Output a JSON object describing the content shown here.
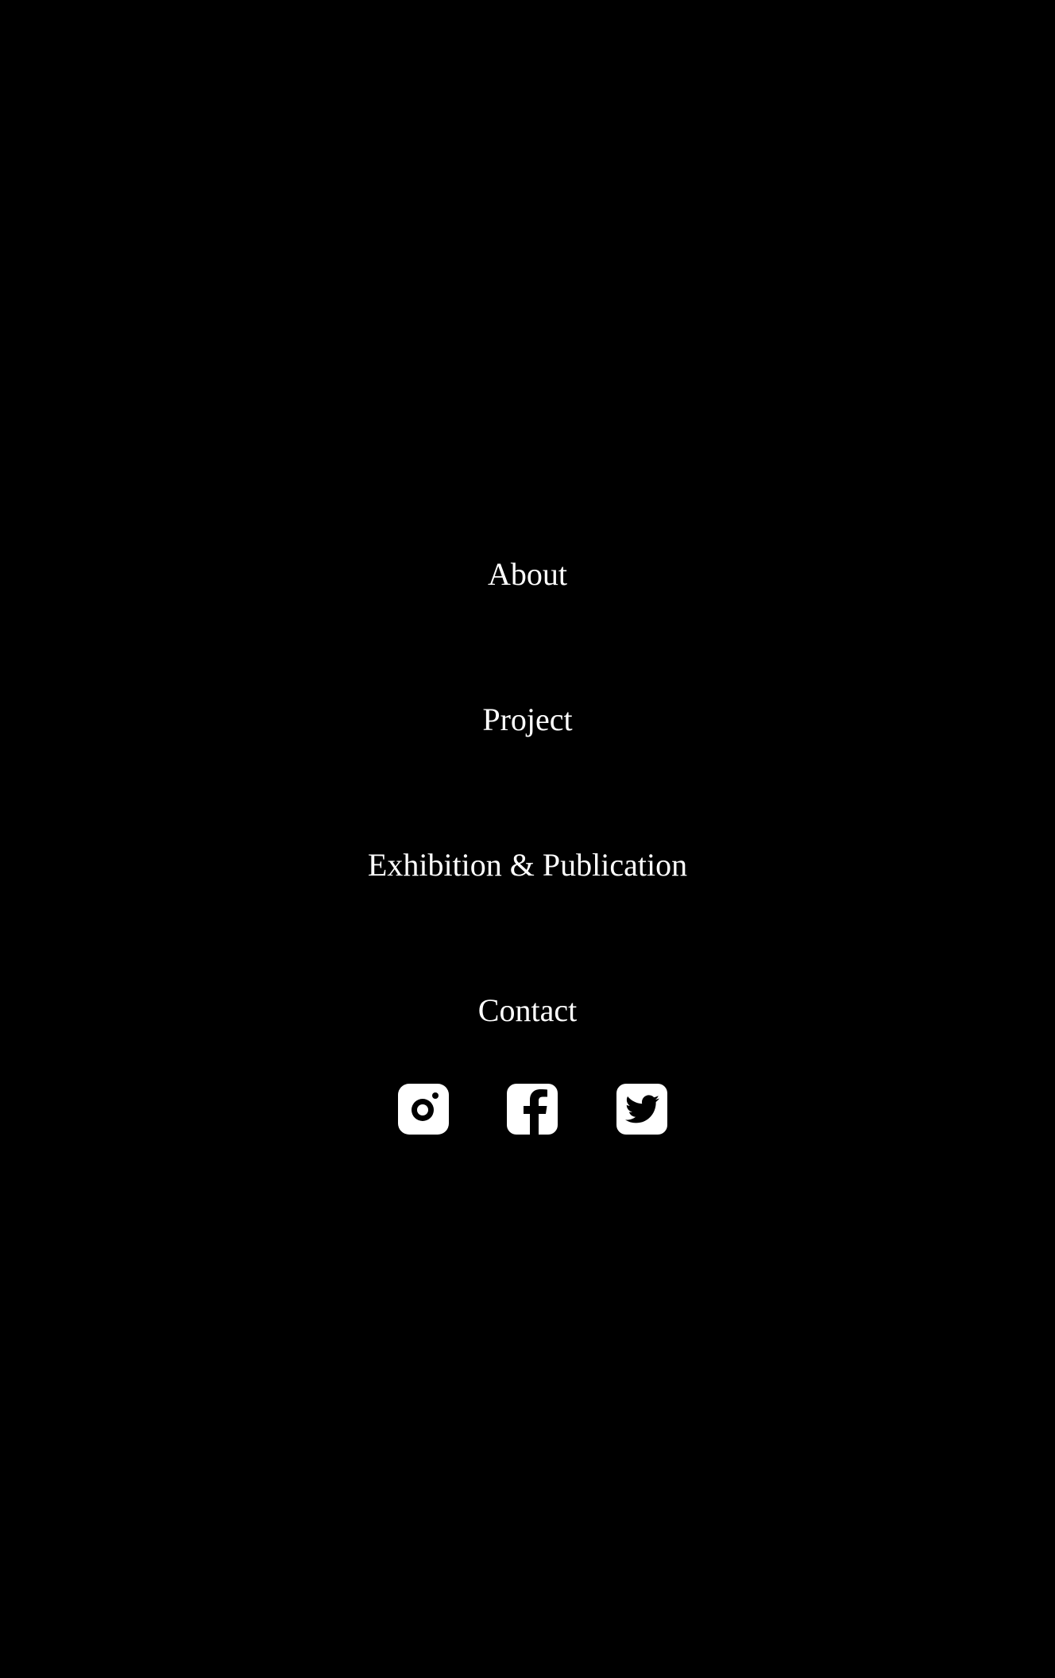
{
  "theme": {
    "background": "#000000",
    "text": "#ffffff"
  },
  "nav": {
    "items": [
      {
        "label": "About"
      },
      {
        "label": "Project"
      },
      {
        "label": "Exhibition & Publication"
      },
      {
        "label": "Contact"
      }
    ]
  },
  "social": {
    "icons": [
      "instagram-icon",
      "facebook-icon",
      "twitter-icon"
    ]
  }
}
